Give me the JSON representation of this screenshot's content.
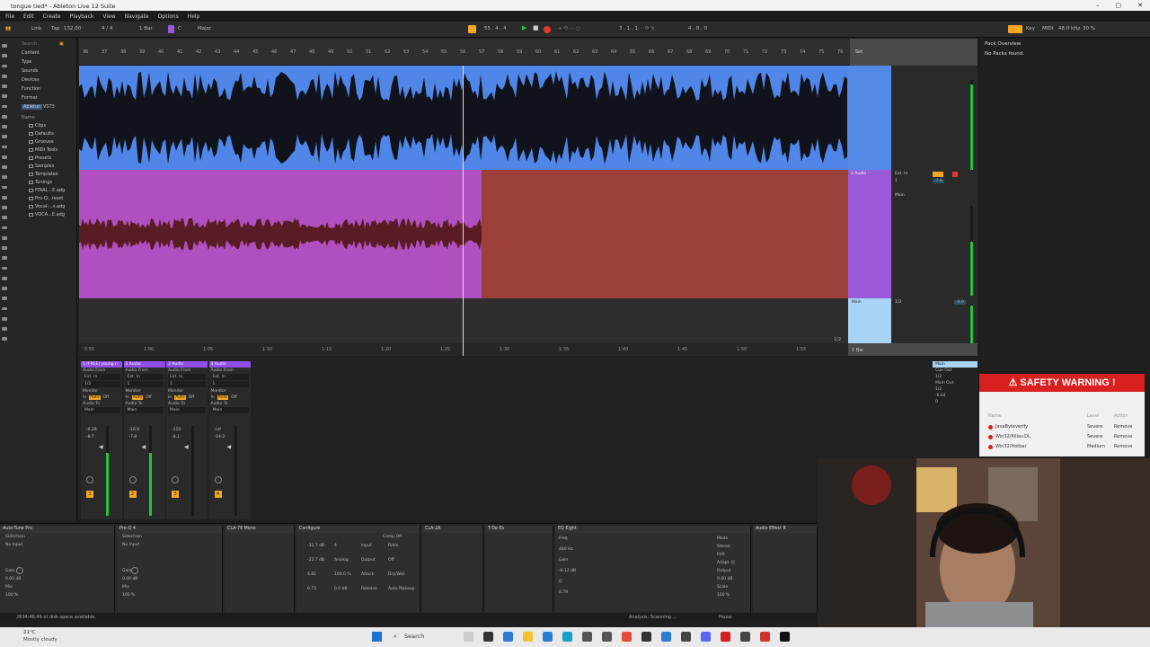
{
  "window": {
    "title": "tongue tied* - Ableton Live 12 Suite"
  },
  "menu": [
    "File",
    "Edit",
    "Create",
    "Playback",
    "View",
    "Navigate",
    "Options",
    "Help"
  ],
  "control_bar": {
    "link": "Link",
    "tap": "Tap",
    "tempo": "132.00",
    "time_sig": "4 / 4",
    "quantize": "1 Bar",
    "key": "C",
    "scale": "Major",
    "position": "55 . 4 . 4",
    "loop_start": "3 . 1 . 1",
    "loop_length": "4 . 0 . 0",
    "key_label": "Key",
    "midi_label": "MIDI",
    "sample_rate": "48.0 kHz",
    "cpu": "30 %"
  },
  "browser": {
    "search_placeholder": "Search",
    "categories": [
      "Content",
      "Type",
      "Sounds",
      "Devices",
      "Function",
      "Format",
      "Ableton",
      "VST3"
    ],
    "name_header": "Name",
    "items": [
      "Clips",
      "Defaults",
      "Grooves",
      "MIDI Tools",
      "Presets",
      "Samples",
      "Templates",
      "Tunings",
      "FINAL...E.adg",
      "Pro-Q...reset",
      "Vocal-...s.adg",
      "VOCA...E.adg"
    ]
  },
  "arrangement": {
    "ruler": [
      "36",
      "37",
      "38",
      "39",
      "40",
      "41",
      "42",
      "43",
      "44",
      "45",
      "46",
      "47",
      "48",
      "49",
      "50",
      "51",
      "52",
      "53",
      "54",
      "55",
      "56",
      "57",
      "58",
      "59",
      "60",
      "61",
      "62",
      "63",
      "64",
      "65",
      "66",
      "67",
      "68",
      "69",
      "70",
      "71",
      "72",
      "73",
      "74",
      "75",
      "76"
    ],
    "timeline": [
      "0:55",
      "1:00",
      "1:05",
      "1:10",
      "1:15",
      "1:20",
      "1:25",
      "1:30",
      "1:35",
      "1:40",
      "1:45",
      "1:50",
      "1:55"
    ],
    "page": "1/2",
    "set_label": "Set",
    "tracks": [
      {
        "name": "1 [FREE] young n",
        "color": "#4f86e8"
      },
      {
        "name": "2 Audio",
        "color": "#a05ad8",
        "io_from": "Ext. In",
        "io_ch": "1",
        "io_to": "Main",
        "volume": "-7.8"
      },
      {
        "name": "Main",
        "color": "#a9d4f5",
        "io": "1/2",
        "volume": "-6.0"
      }
    ],
    "zoom": "1 Bar"
  },
  "mixer": {
    "strips": [
      {
        "name": "1 [FREE] young n",
        "from": "Audio From",
        "src": "Ext. In",
        "ch": "1/2",
        "monitor": "Monitor",
        "mon_opts": [
          "In",
          "Auto",
          "Off"
        ],
        "to": "Audio To",
        "dest": "Main",
        "vol": "-9.29",
        "peak": "-8.7",
        "num": "1"
      },
      {
        "name": "2 Audio",
        "from": "Audio From",
        "src": "Ext. In",
        "ch": "1",
        "monitor": "Monitor",
        "mon_opts": [
          "In",
          "Auto",
          "Off"
        ],
        "to": "Audio To",
        "dest": "Main",
        "vol": "-16.9",
        "peak": "-7.8",
        "num": "2"
      },
      {
        "name": "3 Audio",
        "from": "Audio From",
        "src": "Ext. In",
        "ch": "1",
        "monitor": "Monitor",
        "mon_opts": [
          "In",
          "Auto",
          "Off"
        ],
        "to": "Audio To",
        "dest": "Main",
        "vol": "-110",
        "peak": "-8.1",
        "num": "3"
      },
      {
        "name": "4 Audio",
        "from": "Audio From",
        "src": "Ext. In",
        "ch": "1",
        "monitor": "Monitor",
        "mon_opts": [
          "In",
          "Auto",
          "Off"
        ],
        "to": "Audio To",
        "dest": "Main",
        "vol": "-inf",
        "peak": "-14.2",
        "num": "4"
      }
    ],
    "main": {
      "name": "Main",
      "cue_out": "Cue Out",
      "cue_ch": "1/2",
      "main_out": "Main Out",
      "main_ch": "1/2",
      "vol": "-6.64",
      "peak": "0"
    }
  },
  "devices": [
    {
      "name": "Auto-Tune Pro"
    },
    {
      "name": "Pro-Q 4"
    },
    {
      "name": "CLA-76 Mono"
    },
    {
      "name": "Configure",
      "comp": "Comp Off",
      "values": [
        "-32.7 dB",
        "4",
        "Input",
        "Ratio",
        "-22.7 dB",
        "Analog",
        "Output",
        "Off",
        "4.81",
        "100.0 %",
        "Attack",
        "Dry/Wet",
        "6.73",
        "0.0 dB",
        "Release",
        "Auto Makeup"
      ]
    },
    {
      "name": "CLA-2A"
    },
    {
      "name": "T-De-Es"
    },
    {
      "name": "EQ Eight",
      "freq": "Freq",
      "freq_val": "460 Hz",
      "gain": "Gain",
      "gain_val": "-6.12 dB",
      "q": "Q",
      "q_val": "0.79",
      "mode": "Mode",
      "stereo": "Stereo",
      "edit": "Edit",
      "adapt": "Adapt. Q",
      "output": "Output",
      "out_val": "0.00 dB",
      "scale": "Scale",
      "scale_val": "100 %"
    },
    {
      "name": "Audio Effect R"
    }
  ],
  "sidechain": {
    "label": "Sidechain",
    "input": "No Input",
    "gain": "Gain",
    "gain_val": "0.00 dB",
    "mix": "Mix",
    "mix_val": "100 %"
  },
  "status": {
    "disk": "2634:46:49 of disk space available.",
    "analysis": "Analysis: Scanning ...",
    "pause": "Pause"
  },
  "pack_overview": {
    "title": "Pack Overview",
    "empty": "No Packs found."
  },
  "warning": {
    "title": "SAFETY WARNING !",
    "col_name": "Name",
    "col_level": "Level",
    "col_action": "Action",
    "rows": [
      {
        "name": "JavaByteverify",
        "level": "Severe",
        "action": "Remove"
      },
      {
        "name": "Win32/Killav.DL",
        "level": "Severe",
        "action": "Remove"
      },
      {
        "name": "Win32/Hotbar",
        "level": "Medium",
        "action": "Remove"
      }
    ]
  },
  "taskbar": {
    "temp": "21°C",
    "weather": "Mostly cloudy",
    "search": "Search"
  },
  "colors": {
    "track_blue": "#4f86e8",
    "track_purple": "#b04fbf",
    "clip_red": "#9a3f3a",
    "warning_red": "#d82020",
    "meter_green": "#23c33c",
    "accent_orange": "#f5a623"
  }
}
